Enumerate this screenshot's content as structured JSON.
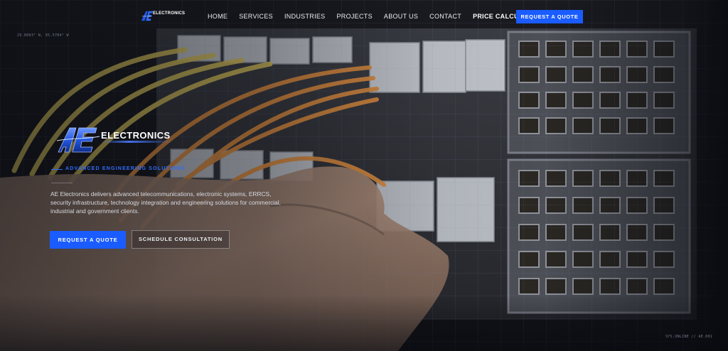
{
  "nav": {
    "logo_text": "ELECTRONICS",
    "links": [
      {
        "label": "HOME"
      },
      {
        "label": "SERVICES"
      },
      {
        "label": "INDUSTRIES"
      },
      {
        "label": "PROJECTS"
      },
      {
        "label": "ABOUT US"
      },
      {
        "label": "CONTACT"
      },
      {
        "label": "PRICE CALCULATOR"
      }
    ],
    "cta_label": "REQUEST A QUOTE"
  },
  "overlay": {
    "coordinates": "29.8093° N, 95.5784° W",
    "system_status": "SYS.ONLINE // AE.001"
  },
  "hero": {
    "brand_name": "ELECTRONICS",
    "tagline": "ADVANCED ENGINEERING SOLUTIONS",
    "description": "AE Electronics delivers advanced telecommunications, electronic systems, ERRCS, security infrastructure, technology integration and engineering solutions for commercial, industrial and government clients.",
    "primary_button": "REQUEST A QUOTE",
    "secondary_button": "SCHEDULE CONSULTATION"
  },
  "colors": {
    "accent": "#1a5cff",
    "background": "#0b0d12",
    "cable_orange": "#d98a3e",
    "cable_yellow": "#d8c25a"
  },
  "icons": {
    "nav_logo": "ae-logo-icon",
    "brand_logo": "ae-logo-icon"
  }
}
